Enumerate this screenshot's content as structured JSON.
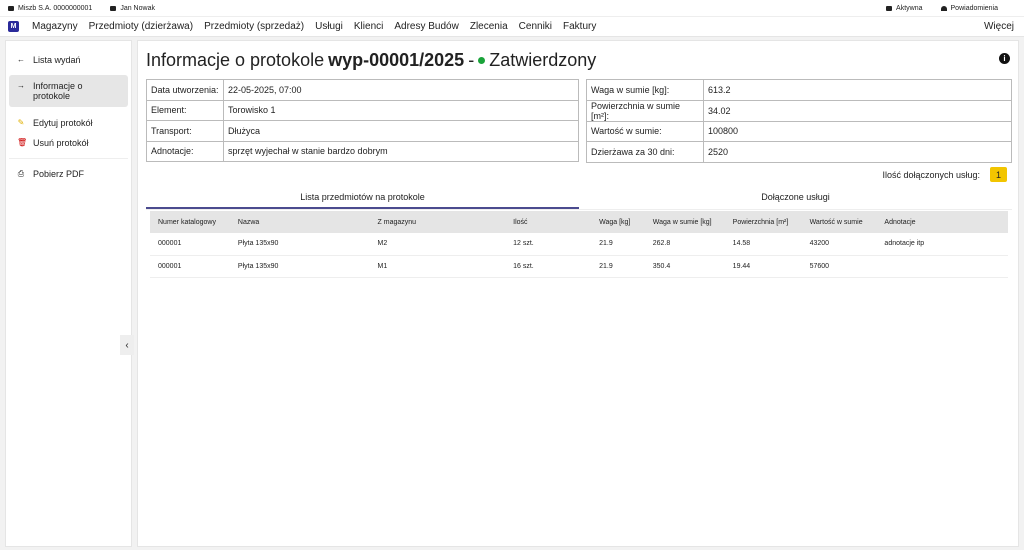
{
  "topbar": {
    "company": "Miszb S.A. 0000000001",
    "user": "Jan Nowak",
    "status": "Aktywna",
    "notifications": "Powiadomienia"
  },
  "nav": {
    "logo": "M",
    "items": [
      "Magazyny",
      "Przedmioty (dzierżawa)",
      "Przedmioty (sprzedaż)",
      "Usługi",
      "Klienci",
      "Adresy Budów",
      "Zlecenia",
      "Cenniki",
      "Faktury"
    ],
    "more": "Więcej"
  },
  "sidebar": {
    "items": [
      {
        "icon": "←",
        "label": "Lista wydań"
      },
      {
        "icon": "→",
        "label": "Informacje o protokole"
      },
      {
        "icon": "✎",
        "label": "Edytuj protokół"
      },
      {
        "icon": "🗑",
        "label": "Usuń protokół"
      },
      {
        "icon": "⎙",
        "label": "Pobierz PDF"
      }
    ],
    "collapse": "‹"
  },
  "header": {
    "prefix": "Informacje o protokole",
    "number": "wyp-00001/2025",
    "sep": "-",
    "status": "Zatwierdzony",
    "status_color": "#1aa33a"
  },
  "details_left": [
    [
      "Data utworzenia:",
      "22-05-2025, 07:00"
    ],
    [
      "Element:",
      "Torowisko 1"
    ],
    [
      "Transport:",
      "Dłużyca"
    ],
    [
      "Adnotacje:",
      "sprzęt wyjechał w stanie bardzo dobrym"
    ]
  ],
  "details_right": [
    [
      "Waga w sumie [kg]:",
      "613.2"
    ],
    [
      "Powierzchnia w sumie [m²]:",
      "34.02"
    ],
    [
      "Wartość w sumie:",
      "100800"
    ],
    [
      "Dzierżawa za 30 dni:",
      "2520"
    ]
  ],
  "services": {
    "label": "Ilość dołączonych usług:",
    "count": "1"
  },
  "tabs": [
    "Lista przedmiotów na protokole",
    "Dołączone usługi"
  ],
  "table": {
    "headers": [
      "Numer katalogowy",
      "Nazwa",
      "Z magazynu",
      "Ilość",
      "Waga [kg]",
      "Waga w sumie [kg]",
      "Powierzchnia [m²]",
      "Wartość w sumie",
      "Adnotacje"
    ],
    "rows": [
      [
        "000001",
        "Płyta 135x90",
        "M2",
        "12 szt.",
        "21.9",
        "262.8",
        "14.58",
        "43200",
        "adnotacje itp"
      ],
      [
        "000001",
        "Płyta 135x90",
        "M1",
        "16 szt.",
        "21.9",
        "350.4",
        "19.44",
        "57600",
        ""
      ]
    ]
  }
}
